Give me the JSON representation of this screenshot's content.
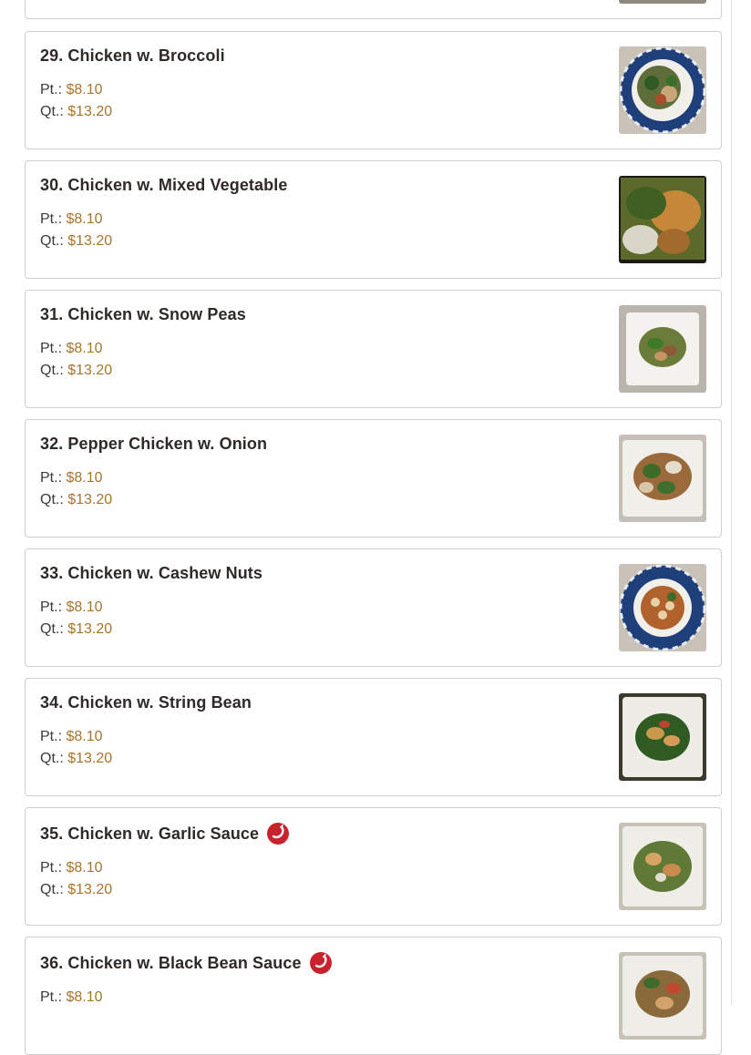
{
  "menu": {
    "pt_label": "Pt.:",
    "qt_label": "Qt.:",
    "items": [
      {
        "name": "29. Chicken w. Broccoli",
        "pt": "$8.10",
        "qt": "$13.20",
        "spicy": false,
        "image": "blue-plate-broccoli"
      },
      {
        "name": "30. Chicken w. Mixed Vegetable",
        "pt": "$8.10",
        "qt": "$13.20",
        "spicy": false,
        "image": "closeup-mixed-vegetable"
      },
      {
        "name": "31. Chicken w. Snow Peas",
        "pt": "$8.10",
        "qt": "$13.20",
        "spicy": false,
        "image": "white-plate-snow-peas"
      },
      {
        "name": "32. Pepper Chicken w. Onion",
        "pt": "$8.10",
        "qt": "$13.20",
        "spicy": false,
        "image": "white-plate-pepper-onion"
      },
      {
        "name": "33. Chicken w. Cashew Nuts",
        "pt": "$8.10",
        "qt": "$13.20",
        "spicy": false,
        "image": "blue-plate-cashew"
      },
      {
        "name": "34. Chicken w. String Bean",
        "pt": "$8.10",
        "qt": "$13.20",
        "spicy": false,
        "image": "white-plate-string-bean"
      },
      {
        "name": "35. Chicken w. Garlic Sauce",
        "pt": "$8.10",
        "qt": "$13.20",
        "spicy": true,
        "image": "white-plate-garlic-sauce"
      },
      {
        "name": "36. Chicken w. Black Bean Sauce",
        "pt": "$8.10",
        "qt": "",
        "spicy": true,
        "image": "white-plate-black-bean"
      }
    ]
  },
  "colors": {
    "price": "#a8742a",
    "spicy_badge": "#c8232c",
    "border": "#cfcfcf"
  },
  "icons": {
    "spicy": "chili-pepper-icon"
  }
}
